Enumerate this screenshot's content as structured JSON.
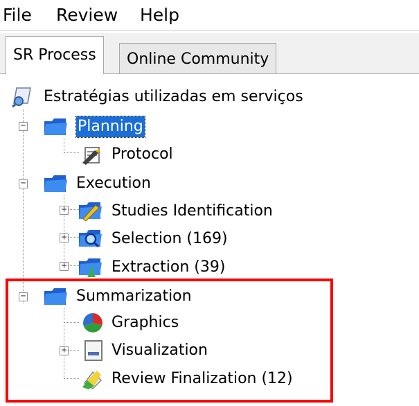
{
  "menubar": {
    "items": [
      "File",
      "Review",
      "Help"
    ]
  },
  "tabs": [
    {
      "label": "SR Process",
      "active": true
    },
    {
      "label": "Online Community",
      "active": false
    }
  ],
  "tree": {
    "root": {
      "label": "Estratégias utilizadas em serviços",
      "icon": "search-document-icon"
    },
    "nodes": [
      {
        "label": "Planning",
        "icon": "folder-icon",
        "expander": "−",
        "selected": true
      },
      {
        "label": "Protocol",
        "icon": "protocol-icon"
      },
      {
        "label": "Execution",
        "icon": "folder-icon",
        "expander": "−"
      },
      {
        "label": "Studies Identification",
        "icon": "studies-identification-icon",
        "expander": "+"
      },
      {
        "label": "Selection (169)",
        "icon": "selection-icon",
        "expander": "+"
      },
      {
        "label": "Extraction (39)",
        "icon": "extraction-icon",
        "expander": "+"
      },
      {
        "label": "Summarization",
        "icon": "folder-icon",
        "expander": "−"
      },
      {
        "label": "Graphics",
        "icon": "pie-chart-icon"
      },
      {
        "label": "Visualization",
        "icon": "visualization-window-icon",
        "expander": "+"
      },
      {
        "label": "Review Finalization (12)",
        "icon": "review-finalization-icon"
      }
    ]
  },
  "colors": {
    "selection": "#1a6ed8",
    "highlight_border": "#ff0000",
    "folder_blue": "#1f5fcf"
  }
}
